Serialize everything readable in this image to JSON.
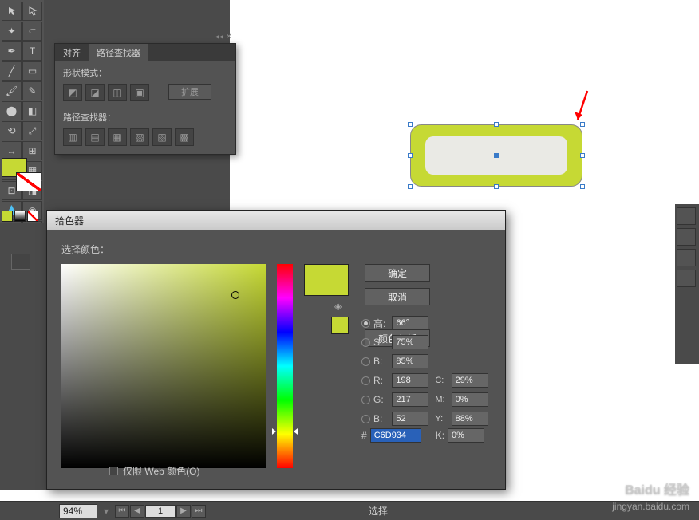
{
  "align_panel": {
    "tab_align": "对齐",
    "tab_pathfinder": "路径查找器",
    "shape_modes": "形状模式：",
    "expand": "扩展",
    "pathfinders": "路径查找器："
  },
  "colorpicker": {
    "title": "拾色器",
    "select_color": "选择颜色：",
    "ok": "确定",
    "cancel": "取消",
    "swatches": "颜色色板",
    "H": {
      "label": "高:",
      "val": "66°"
    },
    "S": {
      "label": "S:",
      "val": "75%"
    },
    "B": {
      "label": "B:",
      "val": "85%"
    },
    "R": {
      "label": "R:",
      "val": "198"
    },
    "G": {
      "label": "G:",
      "val": "217"
    },
    "Bl": {
      "label": "B:",
      "val": "52"
    },
    "C": {
      "label": "C:",
      "val": "29%"
    },
    "M": {
      "label": "M:",
      "val": "0%"
    },
    "Y": {
      "label": "Y:",
      "val": "88%"
    },
    "K": {
      "label": "K:",
      "val": "0%"
    },
    "hex_prefix": "#",
    "hex": "C6D934",
    "web_only": "仅限 Web 颜色(O)"
  },
  "status": {
    "zoom": "94%",
    "page": "1",
    "select": "选择"
  },
  "watermark": {
    "brand": "Baidu 经验",
    "url": "jingyan.baidu.com"
  },
  "colors": {
    "accent": "#c6d934"
  }
}
